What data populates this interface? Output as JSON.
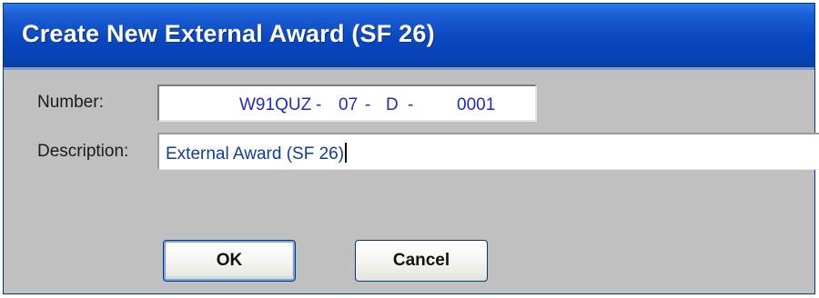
{
  "dialog": {
    "title": "Create New External Award (SF 26)"
  },
  "fields": {
    "number_label": "Number:",
    "number_segments": {
      "prefix": "W91QUZ",
      "sep1": "-",
      "year": "07",
      "sep2": "-",
      "type": "D",
      "sep3": "-",
      "sequence": "0001"
    },
    "description_label": "Description:",
    "description_value": "External Award (SF 26)"
  },
  "buttons": {
    "ok_label": "OK",
    "cancel_label": "Cancel"
  },
  "colors": {
    "titlebar": "#0a46c0",
    "dialog_bg": "#c0c0c0",
    "number_text": "#1d2bd1",
    "description_text": "#0e3aa8"
  }
}
